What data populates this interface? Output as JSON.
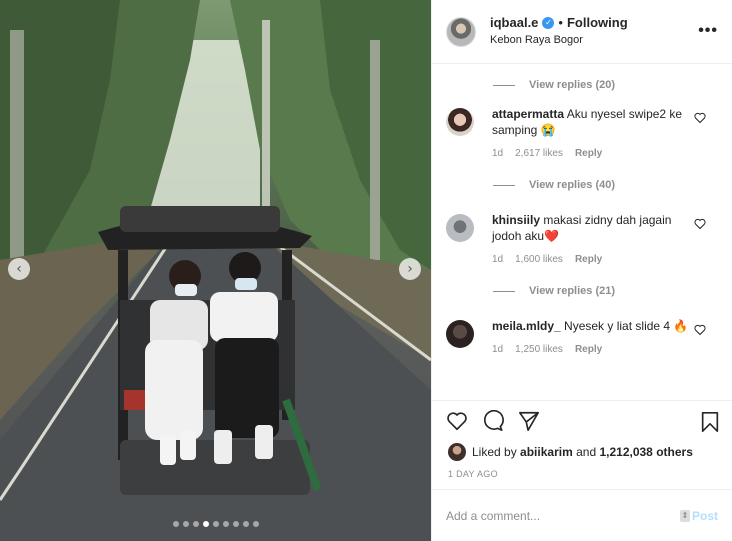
{
  "post": {
    "username": "iqbaal.e",
    "separator": "•",
    "follow_status": "Following",
    "location": "Kebon Raya Bogor",
    "more_icon": "•••"
  },
  "carousel": {
    "prev_glyph": "‹",
    "next_glyph": "›",
    "total_slides": 9,
    "active_slide": 4
  },
  "comments": {
    "view_replies_top": "View replies (20)",
    "items": [
      {
        "user": "attapermatta",
        "text": "Aku nyesel swipe2 ke samping 😭",
        "time": "1d",
        "likes": "2,617 likes",
        "reply": "Reply",
        "view_replies": "View replies (40)"
      },
      {
        "user": "khinsiily",
        "text": "makasi zidny dah jagain jodoh aku❤️",
        "time": "1d",
        "likes": "1,600 likes",
        "reply": "Reply",
        "view_replies": "View replies (21)"
      },
      {
        "user": "meila.mldy_",
        "text": "Nyesek y liat slide 4 🔥",
        "time": "1d",
        "likes": "1,250 likes",
        "reply": "Reply"
      }
    ]
  },
  "likes": {
    "prefix": "Liked by",
    "user": "abiikarim",
    "joiner": "and",
    "others": "1,212,038 others"
  },
  "timestamp": "1 DAY AGO",
  "add_comment": {
    "placeholder": "Add a comment...",
    "post_label": "Post"
  },
  "colors": {
    "verified": "#3897f0",
    "post_button": "#b2dffc",
    "muted": "#8e8e8e"
  }
}
